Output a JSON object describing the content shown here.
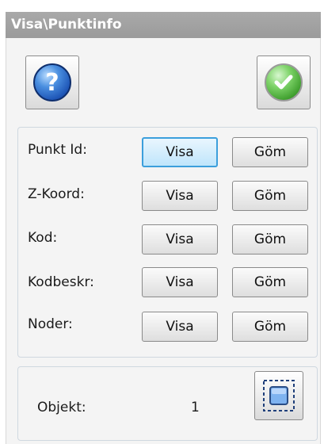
{
  "window": {
    "title": "Visa\\Punktinfo"
  },
  "toolbar": {
    "help_icon": "help-question-icon",
    "confirm_icon": "checkmark-icon"
  },
  "rows": [
    {
      "label": "Punkt Id:",
      "show": "Visa",
      "hide": "Göm",
      "active": "show"
    },
    {
      "label": "Z-Koord:",
      "show": "Visa",
      "hide": "Göm"
    },
    {
      "label": "Kod:",
      "show": "Visa",
      "hide": "Göm"
    },
    {
      "label": "Kodbeskr:",
      "show": "Visa",
      "hide": "Göm"
    },
    {
      "label": "Noder:",
      "show": "Visa",
      "hide": "Göm"
    }
  ],
  "objects": {
    "label": "Objekt:",
    "count": "1",
    "select_icon": "select-objects-icon"
  },
  "colors": {
    "titlebar": "#9e9e9e",
    "active_border": "#3c9fdc",
    "help_blue": "#1d54b5",
    "ok_green": "#3f9f2e"
  }
}
